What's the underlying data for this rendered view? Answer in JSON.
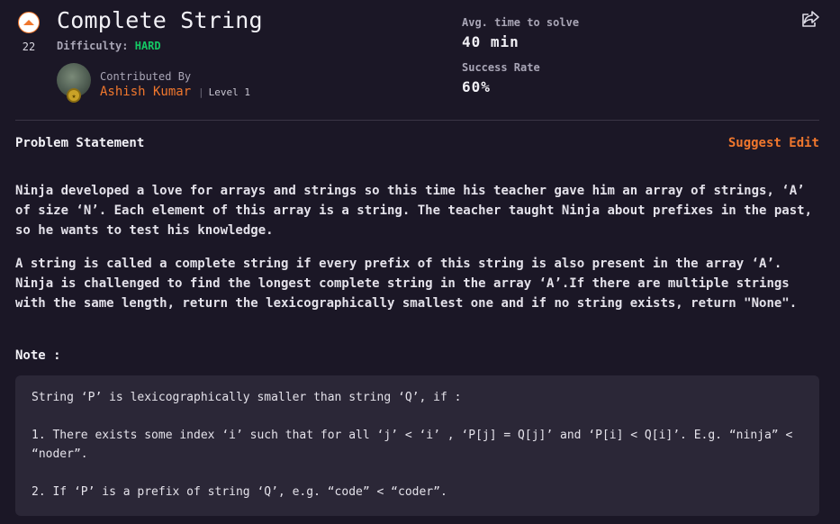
{
  "vote": {
    "count": "22"
  },
  "problem": {
    "title": "Complete String",
    "difficulty_label": "Difficulty:",
    "difficulty_value": "HARD"
  },
  "contributor": {
    "label": "Contributed By",
    "name": "Ashish Kumar",
    "level": "Level 1"
  },
  "stats": {
    "avg_time_label": "Avg. time to solve",
    "avg_time_value": "40 min",
    "success_label": "Success Rate",
    "success_value": "60%"
  },
  "statement": {
    "heading": "Problem Statement",
    "suggest_edit": "Suggest Edit",
    "para1": "Ninja developed a love for arrays and strings so this time his teacher gave him an array of strings, ‘A’ of size ‘N’. Each element of this array is a string. The teacher taught Ninja about prefixes in the past, so he wants to test his knowledge.",
    "para2": "A string is called a complete string if every prefix of this string is also present in the array ‘A’. Ninja is challenged to find the longest complete string in the array ‘A’.If there are multiple strings with the same length, return the lexicographically smallest one and if no string exists, return \"None\".",
    "note_label": "Note :",
    "note_line1": "String ‘P’ is lexicographically smaller than string ‘Q’, if :",
    "note_line2": "1. There exists some index ‘i’ such that for all ‘j’ < ‘i’ , ‘P[j] = Q[j]’ and ‘P[i] < Q[i]’. E.g. “ninja” < “noder”.",
    "note_line3": "2. If ‘P’ is a prefix of string ‘Q’, e.g. “code” < “coder”."
  },
  "colors": {
    "background": "#1b1726",
    "accent": "#f0772d",
    "difficulty_hard": "#14c864",
    "note_box": "#2b2737"
  },
  "icons": {
    "upvote": "upvote-chevron-icon",
    "share": "share-icon",
    "medal": "level-medal-icon"
  }
}
